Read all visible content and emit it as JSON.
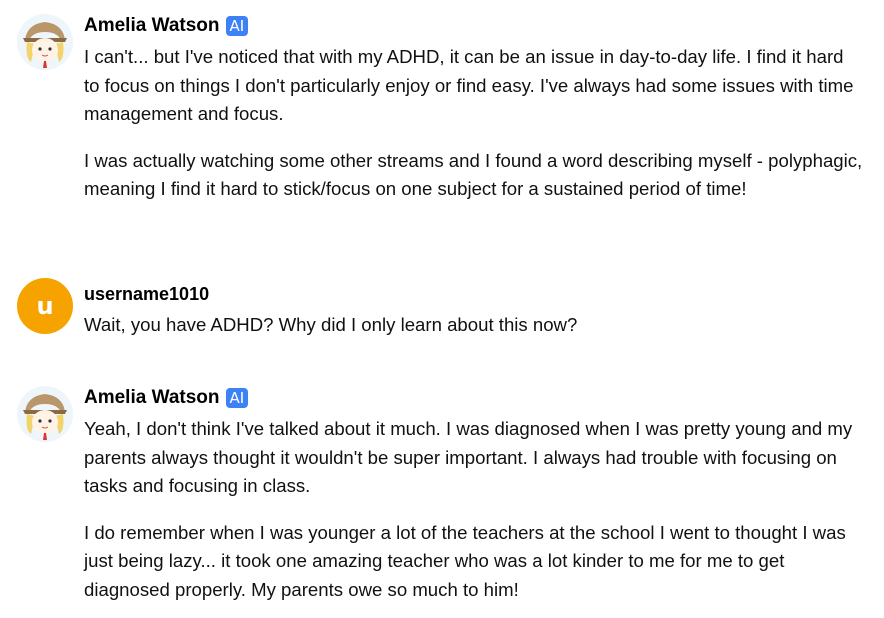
{
  "messages": [
    {
      "sender": "Amelia Watson",
      "badge": "AI",
      "paragraphs": [
        "I can't... but I've noticed that with my ADHD, it can be an issue in day-to-day life. I find it hard to focus on things I don't particularly enjoy or find easy. I've always had some issues with time management and focus.",
        "I was actually watching some other streams and I found a word describing myself - polyphagic, meaning I find it hard to stick/focus on one subject for a sustained period of time!"
      ]
    },
    {
      "sender": "username1010",
      "avatar_letter": "u",
      "paragraphs": [
        "Wait, you have ADHD? Why did I only learn about this now?"
      ]
    },
    {
      "sender": "Amelia Watson",
      "badge": "AI",
      "paragraphs": [
        "Yeah, I don't think I've talked about it much. I was diagnosed when I was pretty young and my parents always thought it wouldn't be super important. I always had trouble with focusing on tasks and focusing in class.",
        "I do remember when I was younger a lot of the teachers at the school I went to thought I was just being lazy... it took one amazing teacher who was a lot kinder to me for me to get diagnosed properly. My parents owe so much to him!"
      ]
    }
  ],
  "colors": {
    "badge_bg": "#3c82f6",
    "user_avatar_bg": "#f6a300"
  }
}
